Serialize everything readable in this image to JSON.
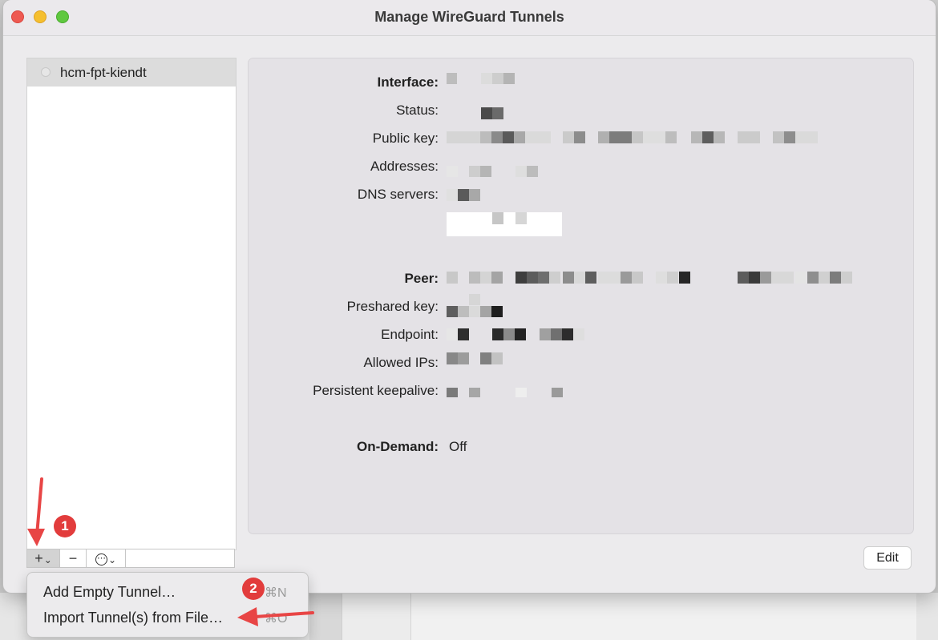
{
  "window": {
    "title": "Manage WireGuard Tunnels"
  },
  "sidebar": {
    "tunnels": [
      {
        "name": "hcm-fpt-kiendt"
      }
    ]
  },
  "toolbar": {
    "add_label": "+",
    "add_chevron": "⌄",
    "remove_label": "−",
    "more_label": "⋯",
    "more_chevron": "⌄"
  },
  "interface": {
    "heading": "Interface:",
    "status_label": "Status:",
    "public_key_label": "Public key:",
    "addresses_label": "Addresses:",
    "dns_label": "DNS servers:"
  },
  "peer": {
    "heading": "Peer:",
    "preshared_key_label": "Preshared key:",
    "endpoint_label": "Endpoint:",
    "allowed_ips_label": "Allowed IPs:",
    "keepalive_label": "Persistent keepalive:"
  },
  "on_demand": {
    "label": "On-Demand:",
    "value": "Off"
  },
  "edit_button": "Edit",
  "add_menu": {
    "items": [
      {
        "label": "Add Empty Tunnel…",
        "shortcut": "⌘N"
      },
      {
        "label": "Import Tunnel(s) from File…",
        "shortcut": "⌘O"
      }
    ]
  },
  "annotations": {
    "step1": "1",
    "step2": "2",
    "arrow_color": "#e84545"
  },
  "colors": {
    "badge": "#e23c3c",
    "selected_row": "#dcdcdc"
  }
}
